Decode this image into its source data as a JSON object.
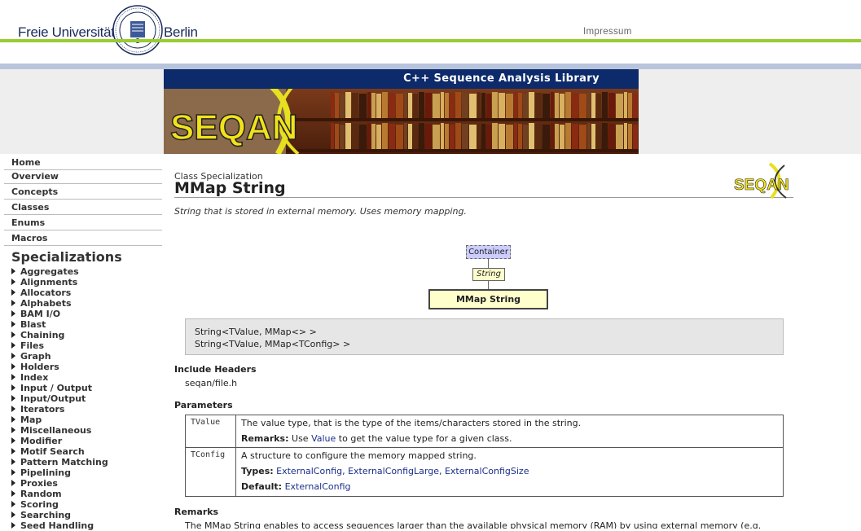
{
  "header": {
    "left_text": "Freie Universität",
    "right_text": "Berlin",
    "impressum": "Impressum"
  },
  "banner": {
    "title": "C++ Sequence Analysis Library",
    "logo_text": "SEQAN"
  },
  "sidebar": {
    "main_items": [
      {
        "label": "Home"
      },
      {
        "label": "Overview"
      },
      {
        "label": "Concepts"
      },
      {
        "label": "Classes"
      },
      {
        "label": "Enums"
      },
      {
        "label": "Macros"
      }
    ],
    "spec_heading": "Specializations",
    "spec_items": [
      "Aggregates",
      "Alignments",
      "Allocators",
      "Alphabets",
      "BAM I/O",
      "Blast",
      "Chaining",
      "Files",
      "Graph",
      "Holders",
      "Index",
      "Input / Output",
      "Input/Output",
      "Iterators",
      "Map",
      "Miscellaneous",
      "Modifier",
      "Motif Search",
      "Pattern Matching",
      "Pipelining",
      "Proxies",
      "Random",
      "Scoring",
      "Searching",
      "Seed Handling"
    ]
  },
  "content": {
    "class_kind": "Class Specialization",
    "class_name": "MMap String",
    "description": "String that is stored in external memory. Uses memory mapping.",
    "diagram": {
      "container": "Container",
      "string": "String",
      "mmap": "MMap String"
    },
    "signatures": [
      "String<TValue, MMap<> >",
      "String<TValue, MMap<TConfig> >"
    ],
    "include_heading": "Include Headers",
    "include_value": "seqan/file.h",
    "params_heading": "Parameters",
    "params": [
      {
        "name": "TValue",
        "desc": "The value type, that is the type of the items/characters stored in the string.",
        "remarks_label": "Remarks:",
        "remarks_pre": "Use",
        "remarks_link": "Value",
        "remarks_post": "to get the value type for a given class."
      },
      {
        "name": "TConfig",
        "desc": "A structure to configure the memory mapped string.",
        "types_label": "Types:",
        "types_links": "ExternalConfig, ExternalConfigLarge, ExternalConfigSize",
        "default_label": "Default:",
        "default_link": "ExternalConfig"
      }
    ],
    "remarks_heading": "Remarks",
    "remarks_text": "The MMap String enables to access sequences larger than the available physical memory (RAM) by using external memory (e.g."
  }
}
